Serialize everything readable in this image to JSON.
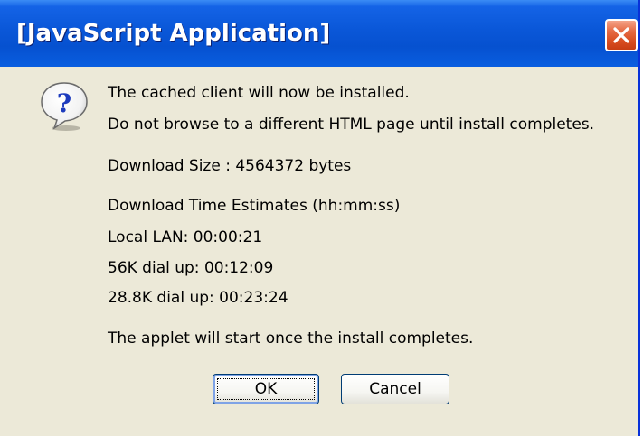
{
  "window": {
    "title": "[JavaScript Application]"
  },
  "message": {
    "icon": "question-icon",
    "lines": [
      "The cached client will now be installed.",
      "Do not browse to a different HTML page until install completes.",
      "Download Size : 4564372 bytes",
      "Download Time Estimates (hh:mm:ss)",
      "Local LAN: 00:00:21",
      "56K dial up: 00:12:09",
      "28.8K dial up: 00:23:24",
      "The applet will start once the install completes."
    ]
  },
  "buttons": {
    "ok_label": "OK",
    "cancel_label": "Cancel"
  },
  "colors": {
    "titlebar": "#0a57d8",
    "close_button": "#d94d21",
    "dialog_background": "#ece9d8",
    "button_border": "#003c74"
  }
}
